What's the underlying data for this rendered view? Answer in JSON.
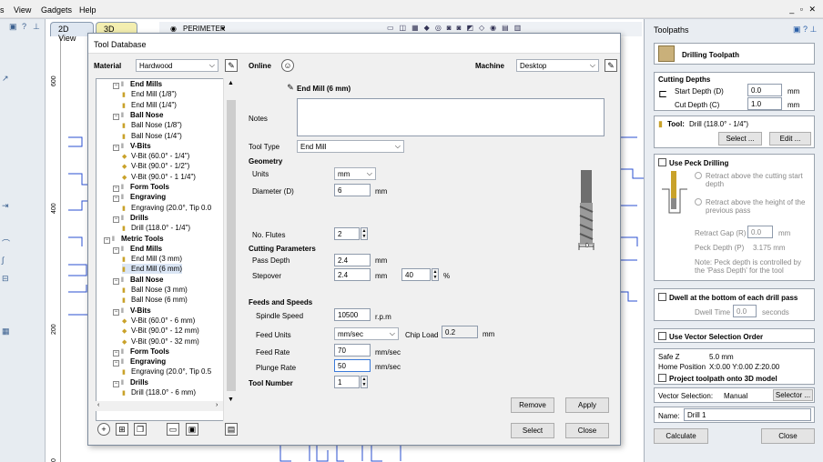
{
  "menubar": {
    "items": [
      "s",
      "View",
      "Gadgets",
      "Help"
    ]
  },
  "viewtabs": {
    "tab_2d": "2D View",
    "tab_3d": "3D View",
    "perimeter": "PERIMETER"
  },
  "ruler": {
    "labels": [
      "600",
      "400",
      "200",
      "0"
    ]
  },
  "dialog": {
    "title": "Tool Database",
    "material_label": "Material",
    "material_value": "Hardwood",
    "online_label": "Online",
    "machine_label": "Machine",
    "machine_value": "Desktop",
    "tree": [
      {
        "text": "End Mills",
        "level": 1,
        "kind": "group"
      },
      {
        "text": "End Mill (1/8\")",
        "level": 2,
        "kind": "em"
      },
      {
        "text": "End Mill (1/4\")",
        "level": 2,
        "kind": "em"
      },
      {
        "text": "Ball Nose",
        "level": 1,
        "kind": "group"
      },
      {
        "text": "Ball Nose (1/8\")",
        "level": 2,
        "kind": "bn"
      },
      {
        "text": "Ball Nose (1/4\")",
        "level": 2,
        "kind": "bn"
      },
      {
        "text": "V-Bits",
        "level": 1,
        "kind": "group"
      },
      {
        "text": "V-Bit (60.0° - 1/4\")",
        "level": 2,
        "kind": "vb"
      },
      {
        "text": "V-Bit (90.0° - 1/2\")",
        "level": 2,
        "kind": "vb"
      },
      {
        "text": "V-Bit (90.0° - 1 1/4\")",
        "level": 2,
        "kind": "vb"
      },
      {
        "text": "Form Tools",
        "level": 1,
        "kind": "group"
      },
      {
        "text": "Engraving",
        "level": 1,
        "kind": "group"
      },
      {
        "text": "Engraving (20.0°, Tip 0.0",
        "level": 2,
        "kind": "en"
      },
      {
        "text": "Drills",
        "level": 1,
        "kind": "group"
      },
      {
        "text": "Drill (118.0° - 1/4\")",
        "level": 2,
        "kind": "dr"
      },
      {
        "text": "Metric Tools",
        "level": 0,
        "kind": "group"
      },
      {
        "text": "End Mills",
        "level": 1,
        "kind": "group"
      },
      {
        "text": "End Mill (3 mm)",
        "level": 2,
        "kind": "em"
      },
      {
        "text": "End Mill (6 mm)",
        "level": 2,
        "kind": "em",
        "selected": true
      },
      {
        "text": "Ball Nose",
        "level": 1,
        "kind": "group"
      },
      {
        "text": "Ball Nose (3 mm)",
        "level": 2,
        "kind": "bn"
      },
      {
        "text": "Ball Nose (6 mm)",
        "level": 2,
        "kind": "bn"
      },
      {
        "text": "V-Bits",
        "level": 1,
        "kind": "group"
      },
      {
        "text": "V-Bit (60.0° - 6 mm)",
        "level": 2,
        "kind": "vb"
      },
      {
        "text": "V-Bit (90.0° - 12 mm)",
        "level": 2,
        "kind": "vb"
      },
      {
        "text": "V-Bit (90.0° - 32 mm)",
        "level": 2,
        "kind": "vb"
      },
      {
        "text": "Form Tools",
        "level": 1,
        "kind": "group"
      },
      {
        "text": "Engraving",
        "level": 1,
        "kind": "group"
      },
      {
        "text": "Engraving (20.0°, Tip 0.5",
        "level": 2,
        "kind": "en"
      },
      {
        "text": "Drills",
        "level": 1,
        "kind": "group"
      },
      {
        "text": "Drill (118.0° - 6 mm)",
        "level": 2,
        "kind": "dr"
      }
    ],
    "tool_name": "End Mill (6 mm)",
    "notes_label": "Notes",
    "tool_type_label": "Tool Type",
    "tool_type_value": "End Mill",
    "geometry_label": "Geometry",
    "units_label": "Units",
    "units_value": "mm",
    "diameter_label": "Diameter (D)",
    "diameter_value": "6",
    "diameter_unit": "mm",
    "flutes_label": "No. Flutes",
    "flutes_value": "2",
    "cutting_label": "Cutting Parameters",
    "pass_depth_label": "Pass Depth",
    "pass_depth_value": "2.4",
    "pass_depth_unit": "mm",
    "stepover_label": "Stepover",
    "stepover_value": "2.4",
    "stepover_unit": "mm",
    "stepover_pct": "40",
    "pct_sign": "%",
    "feeds_label": "Feeds and Speeds",
    "spindle_label": "Spindle Speed",
    "spindle_value": "10500",
    "spindle_unit": "r.p.m",
    "feed_units_label": "Feed Units",
    "feed_units_value": "mm/sec",
    "chip_load_label": "Chip Load",
    "chip_load_value": "0.2",
    "chip_load_unit": "mm",
    "feed_rate_label": "Feed Rate",
    "feed_rate_value": "70",
    "feed_rate_unit": "mm/sec",
    "plunge_label": "Plunge Rate",
    "plunge_value": "50",
    "plunge_unit": "mm/sec",
    "tool_number_label": "Tool Number",
    "tool_number_value": "1",
    "remove": "Remove",
    "apply": "Apply",
    "select": "Select",
    "close": "Close",
    "diagram_d_label": "D"
  },
  "panel": {
    "header": "Toolpaths",
    "title": "Drilling Toolpath",
    "cutting_depths": "Cutting Depths",
    "start_depth_label": "Start Depth (D)",
    "start_depth_value": "0.0",
    "cut_depth_label": "Cut Depth (C)",
    "cut_depth_value": "1.0",
    "unit": "mm",
    "tool_label": "Tool:",
    "tool_value": "Drill (118.0° - 1/4\")",
    "select_btn": "Select ...",
    "edit_btn": "Edit ...",
    "peck_label": "Use Peck Drilling",
    "retract_above_start": "Retract above the cutting start depth",
    "retract_above_height": "Retract above the height of the previous pass",
    "retract_gap_label": "Retract Gap (R)",
    "retract_gap_value": "0.0",
    "peck_depth_label": "Peck Depth (P)",
    "peck_depth_value": "3.175 mm",
    "peck_note": "Note: Peck depth is controlled by the 'Pass Depth' for the tool",
    "dwell_label": "Dwell at the bottom of each drill pass",
    "dwell_time_label": "Dwell Time",
    "dwell_time_value": "0.0",
    "dwell_unit": "seconds",
    "vector_order_label": "Use Vector Selection Order",
    "safe_z_label": "Safe Z",
    "safe_z_value": "5.0 mm",
    "home_label": "Home Position",
    "home_value": "X:0.00 Y:0.00 Z:20.00",
    "project_label": "Project toolpath onto 3D model",
    "vector_sel_label": "Vector Selection:",
    "vector_sel_value": "Manual",
    "selector_btn": "Selector ...",
    "name_label": "Name:",
    "name_value": "Drill 1",
    "calculate": "Calculate",
    "close": "Close"
  }
}
